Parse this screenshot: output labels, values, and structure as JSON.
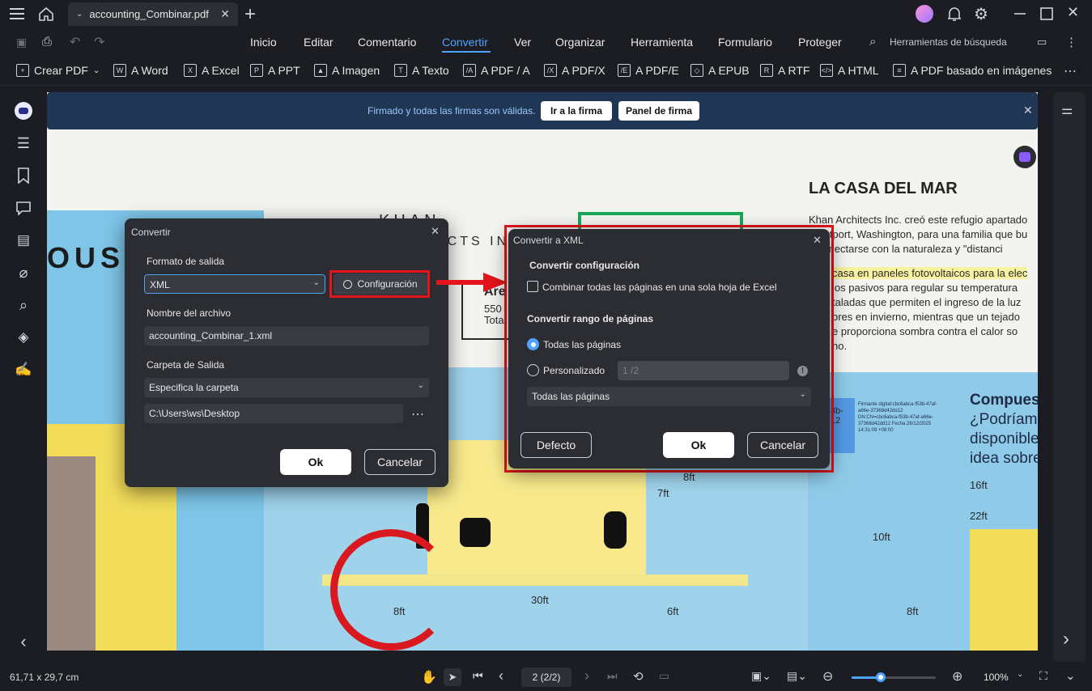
{
  "titlebar": {
    "tab_title": "accounting_Combinar.pdf"
  },
  "menu": {
    "items": [
      "Inicio",
      "Editar",
      "Comentario",
      "Convertir",
      "Ver",
      "Organizar",
      "Herramienta",
      "Formulario",
      "Proteger"
    ],
    "search_label": "Herramientas de búsqueda"
  },
  "toolbar": {
    "items": [
      "Crear PDF",
      "A Word",
      "A Excel",
      "A PPT",
      "A Imagen",
      "A Texto",
      "A PDF / A",
      "A PDF/X",
      "A PDF/E",
      "A EPUB",
      "A RTF",
      "A HTML",
      "A PDF basado en imágenes"
    ]
  },
  "banner": {
    "text": "Firmado y todas las firmas son válidas.",
    "go_button": "Ir a la firma",
    "panel_button": "Panel de firma"
  },
  "document": {
    "heading": "LA CASA DEL MAR",
    "para_lines": [
      "Khan Architects Inc. creó este refugio apartado",
      "Westport, Washington, para una familia que bu",
      "a conectarse con la naturaleza y \"distanci"
    ],
    "highlight_line": "casa en paneles fotovoltaicos para la elec",
    "para2_lines": [
      "ios pasivos para regular su temperatura",
      "taladas que permiten el ingreso de la luz",
      "ores en invierno, mientras que un tejado",
      "e proporciona sombra contra el calor so",
      "no."
    ],
    "left_title": "OUSE",
    "khan_text": "KHAN",
    "ects_text": "ECTS IN",
    "area_label": "Are",
    "area_num": "550",
    "area_total": "Tota",
    "sig_block": "Firmante digital:cbc6abca-f53b-47af-a66e-37368d42dd12 DN:CN=cbc6abca-f53b-47af-a66e-37368d42dd12 Fecha:26/12/2025 14:31:09 +08:00",
    "sig_left": "3b- 12",
    "compues_lines": [
      "Compues",
      "¿Podríam",
      "disponible",
      "idea sobre"
    ],
    "dims": [
      "8ft",
      "7ft",
      "30ft",
      "8ft",
      "6ft",
      "16ft",
      "22ft",
      "10ft",
      "8ft"
    ]
  },
  "dialog_convert": {
    "title": "Convertir",
    "format_label": "Formato de salida",
    "format_value": "XML",
    "config_button": "Configuración",
    "filename_label": "Nombre del archivo",
    "filename_value": "accounting_Combinar_1.xml",
    "folder_label": "Carpeta de Salida",
    "folder_option": "Especifica la carpeta",
    "folder_path": "C:\\Users\\ws\\Desktop",
    "ok": "Ok",
    "cancel": "Cancelar"
  },
  "dialog_xml": {
    "title": "Convertir a XML",
    "config_heading": "Convertir configuración",
    "combine_label": "Combinar todas las páginas en una sola hoja de Excel",
    "range_heading": "Convertir rango de páginas",
    "all_pages": "Todas las páginas",
    "custom": "Personalizado",
    "custom_placeholder": "1 /2",
    "select_value": "Todas las páginas",
    "default": "Defecto",
    "ok": "Ok",
    "cancel": "Cancelar"
  },
  "status": {
    "dimensions": "61,71 x 29,7 cm",
    "page": "2 (2/2)",
    "zoom": "100%",
    "zoom_fraction": 0.35
  },
  "colors": {
    "accent": "#4da3ff",
    "highlight_red": "#e3141b",
    "banner_bg": "#1f3654"
  }
}
